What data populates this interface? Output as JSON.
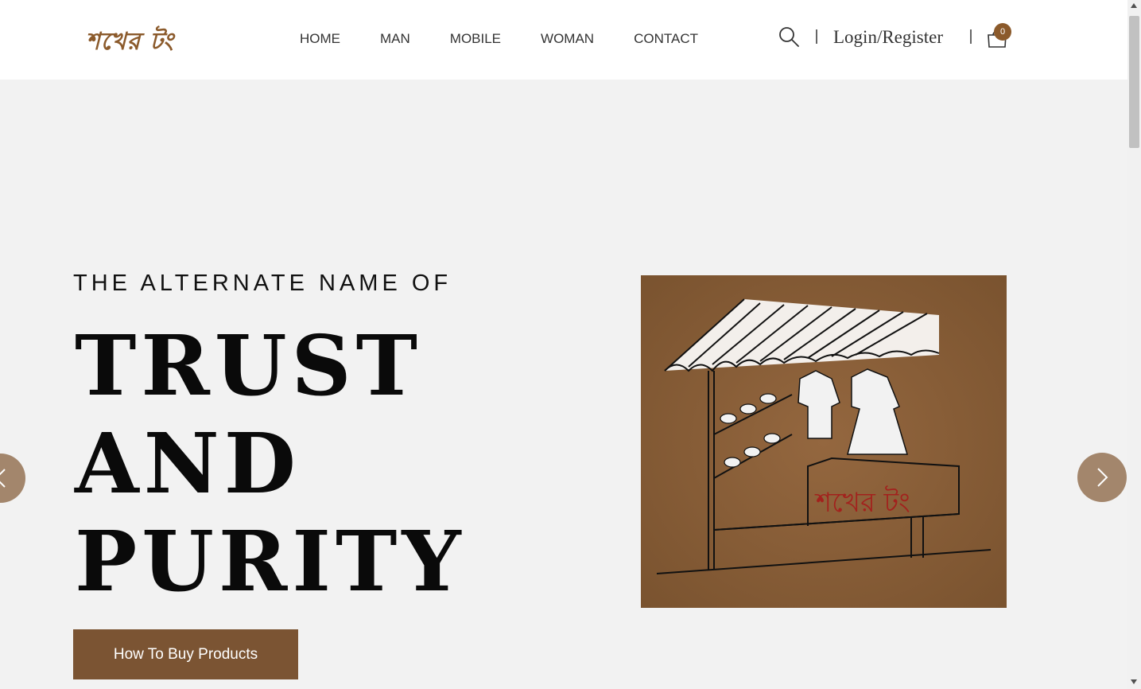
{
  "brand": {
    "logo_text": "শখের টং",
    "accent_color": "#8b5a2b"
  },
  "nav": {
    "items": [
      {
        "label": "HOME"
      },
      {
        "label": "MAN"
      },
      {
        "label": "MOBILE"
      },
      {
        "label": "WOMAN"
      },
      {
        "label": "CONTACT"
      }
    ]
  },
  "header": {
    "login_label": "Login/Register",
    "cart_count": "0",
    "search_icon": "search-icon",
    "cart_icon": "shopping-bag-icon"
  },
  "hero": {
    "subtitle": "THE ALTERNATE NAME OF",
    "title_lines": [
      "TRUST",
      "AND",
      "PURITY"
    ],
    "cta_label": "How To Buy Products",
    "image_sign_text": "শখের টং",
    "cta_color": "#7b5433",
    "arrow_color": "#a3866c"
  }
}
